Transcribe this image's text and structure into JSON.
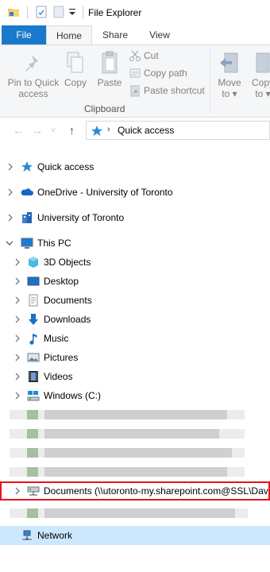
{
  "window": {
    "title": "File Explorer"
  },
  "ribbon": {
    "tabs": [
      {
        "label": "File"
      },
      {
        "label": "Home"
      },
      {
        "label": "Share"
      },
      {
        "label": "View"
      }
    ],
    "clipboard": {
      "pin_line1": "Pin to Quick",
      "pin_line2": "access",
      "copy": "Copy",
      "paste": "Paste",
      "cut": "Cut",
      "copy_path": "Copy path",
      "paste_shortcut": "Paste shortcut",
      "group_label": "Clipboard"
    },
    "organize": {
      "move_to": "Move",
      "move_to_arrow": "to ▾",
      "copy_to": "Copy",
      "copy_to_arrow": "to ▾"
    }
  },
  "address_bar": {
    "path": "Quick access"
  },
  "tree": {
    "quick_access": "Quick access",
    "onedrive": "OneDrive - University of Toronto",
    "university": "University of Toronto",
    "this_pc": "This PC",
    "pc_items": [
      {
        "label": "3D Objects"
      },
      {
        "label": "Desktop"
      },
      {
        "label": "Documents"
      },
      {
        "label": "Downloads"
      },
      {
        "label": "Music"
      },
      {
        "label": "Pictures"
      },
      {
        "label": "Videos"
      },
      {
        "label": "Windows (C:)"
      }
    ],
    "highlighted_drive": "Documents (\\\\utoronto-my.sharepoint.com@SSL\\Dav",
    "network": "Network"
  },
  "colors": {
    "accent": "#1979ca",
    "highlight_border": "#e8141c",
    "selection": "#cce8ff"
  }
}
